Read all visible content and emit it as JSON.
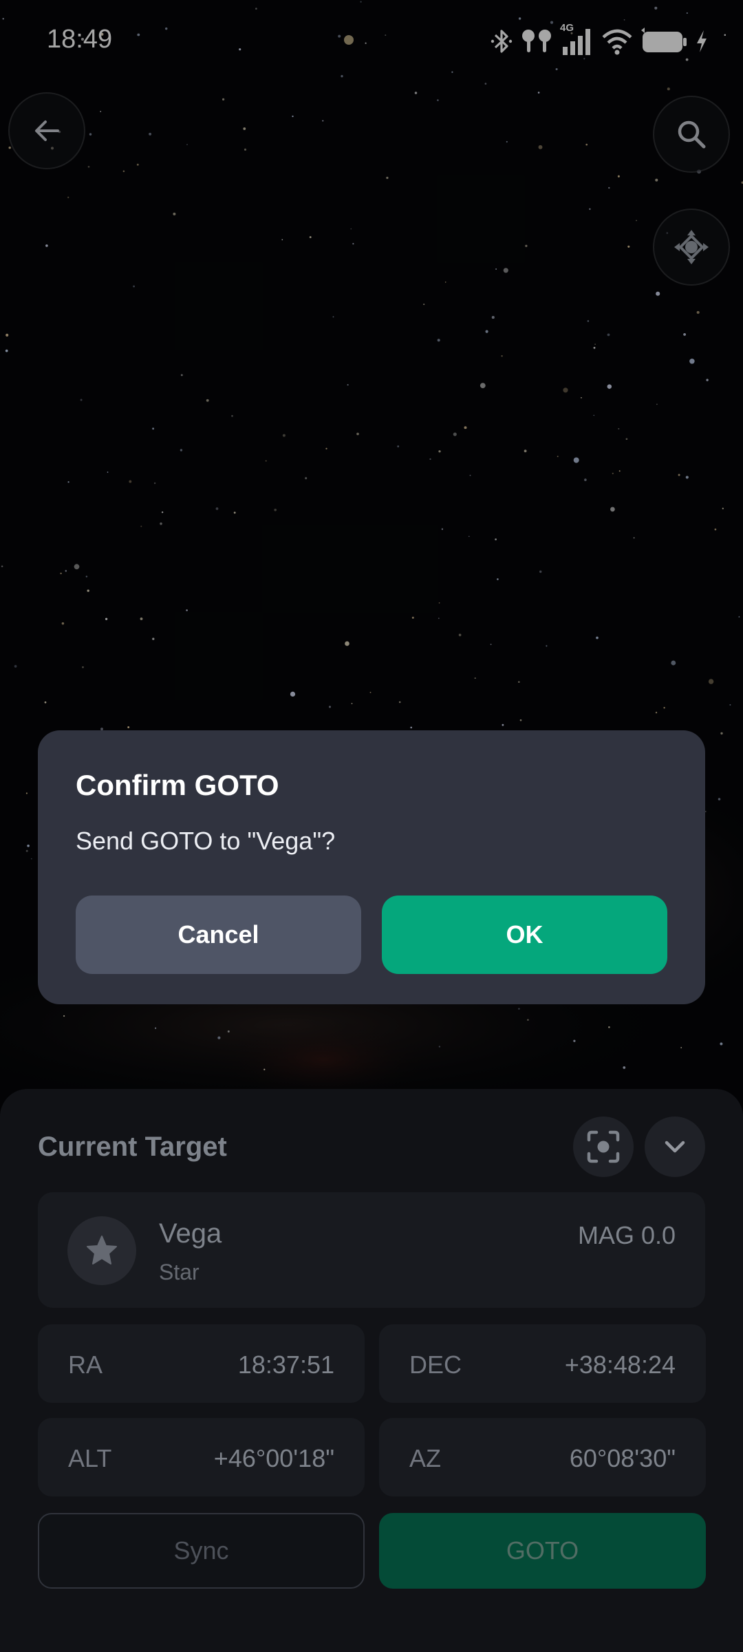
{
  "status_bar": {
    "time": "18:49",
    "icons": [
      "bluetooth-icon",
      "earbuds-icon",
      "signal-4g-icon",
      "wifi-icon",
      "battery-icon",
      "charging-icon"
    ],
    "network_label": "4G"
  },
  "map_controls": {
    "back_icon": "arrow-left-icon",
    "search_icon": "search-icon",
    "center_icon": "recenter-icon"
  },
  "dialog": {
    "title": "Confirm GOTO",
    "message": "Send GOTO to \"Vega\"?",
    "cancel_label": "Cancel",
    "ok_label": "OK"
  },
  "sheet": {
    "title": "Current Target",
    "target": {
      "name": "Vega",
      "type": "Star",
      "magnitude": "MAG 0.0"
    },
    "coords": {
      "ra": {
        "label": "RA",
        "value": "18:37:51"
      },
      "dec": {
        "label": "DEC",
        "value": "+38:48:24"
      },
      "alt": {
        "label": "ALT",
        "value": "+46°00'18\""
      },
      "az": {
        "label": "AZ",
        "value": "60°08'30\""
      }
    },
    "sync_label": "Sync",
    "goto_label": "GOTO"
  },
  "colors": {
    "accent": "#05a77c",
    "goto_dim": "#065c44",
    "dialog_bg": "#30333f",
    "sheet_bg": "#15171c"
  }
}
